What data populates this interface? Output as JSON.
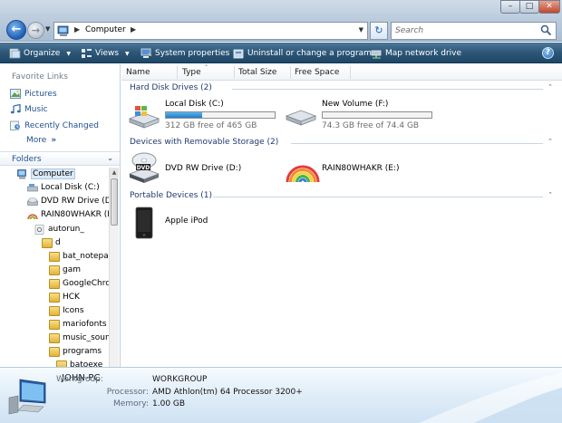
{
  "address_bar": {
    "path": "Computer",
    "search_placeholder": "Search"
  },
  "window_controls": {
    "minimize": "–",
    "maximize": "□",
    "close": "✕"
  },
  "toolbar": {
    "organize": "Organize",
    "views": "Views",
    "system_properties": "System properties",
    "uninstall": "Uninstall or change a program",
    "map_drive": "Map network drive",
    "help": "?"
  },
  "nav": {
    "favorite_links_title": "Favorite Links",
    "favorites": [
      "Pictures",
      "Music",
      "Recently Changed"
    ],
    "more": "More",
    "folders_label": "Folders",
    "tree": [
      "Computer",
      "Local Disk (C:)",
      "DVD RW Drive (D:",
      "RAIN80WHAKR (E",
      "autorun_",
      "d",
      "bat_notepac",
      "gam",
      "GoogleChrc",
      "HCK",
      "Icons",
      "mariofonts",
      "music_soun",
      "programs",
      "batoexe"
    ]
  },
  "columns": [
    "Name",
    "Type",
    "Total Size",
    "Free Space"
  ],
  "groups": {
    "hard_disks": "Hard Disk Drives (2)",
    "removable": "Devices with Removable Storage (2)",
    "portable": "Portable Devices (1)"
  },
  "drives": {
    "c_label": "Local Disk (C:)",
    "c_free": "312 GB free of 465 GB",
    "c_used_fraction": 0.33,
    "f_label": "New Volume (F:)",
    "f_free": "74.3 GB free of 74.4 GB",
    "f_used_fraction": 0.0,
    "dvd_label": "DVD RW Drive (D:)",
    "rainbow_label": "RAIN80WHAKR (E:)",
    "ipod_label": "Apple iPod"
  },
  "details": {
    "computer_name": "JOHN-PC",
    "workgroup_key": "Workgroup:",
    "workgroup_val": "WORKGROUP",
    "processor_key": "Processor:",
    "processor_val": "AMD Athlon(tm) 64 Processor 3200+",
    "memory_key": "Memory:",
    "memory_val": "1.00 GB"
  }
}
